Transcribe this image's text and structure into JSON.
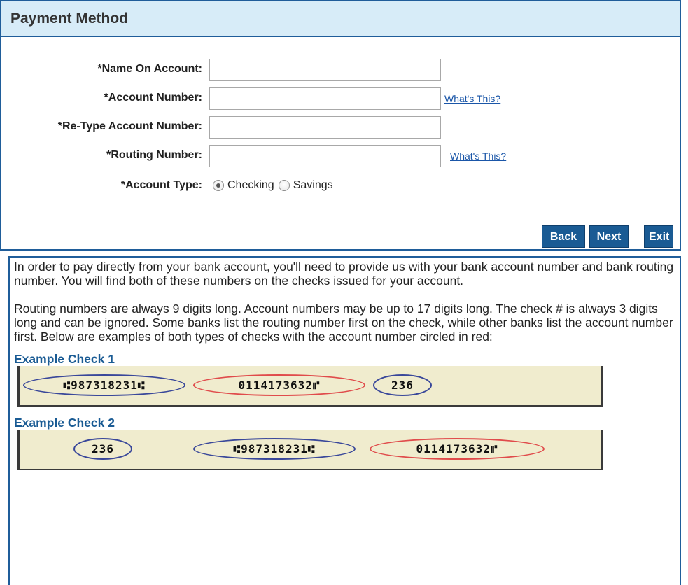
{
  "panel": {
    "title": "Payment Method",
    "fields": {
      "name_label": "*Name On Account:",
      "account_label": "*Account Number:",
      "retype_label": "*Re-Type Account Number:",
      "routing_label": "*Routing Number:",
      "type_label": "*Account Type:",
      "name_value": "",
      "account_value": "",
      "retype_value": "",
      "routing_value": ""
    },
    "whats_this": "What's This?",
    "account_types": {
      "checking": "Checking",
      "savings": "Savings",
      "selected": "Checking"
    },
    "buttons": {
      "back": "Back",
      "next": "Next",
      "exit": "Exit"
    }
  },
  "help": {
    "paragraph1": "In order to pay directly from your bank account, you'll need to provide us with your bank account number and bank routing number. You will find both of these numbers on the checks issued for your account.",
    "paragraph2": "Routing numbers are always 9 digits long. Account numbers may be up to 17 digits long. The check # is always 3 digits long and can be ignored. Some banks list the routing number first on the check, while other banks list the account number first. Below are examples of both types of checks with the account number circled in red:",
    "example1": {
      "title": "Example Check 1",
      "routing": "⑆987318231⑆",
      "account": "0114173632⑈",
      "check_no": "236"
    },
    "example2": {
      "title": "Example Check 2",
      "check_no": "236",
      "routing": "⑆987318231⑆",
      "account": "0114173632⑈"
    }
  },
  "colors": {
    "header_bg": "#d7ecf8",
    "border": "#1f5d9a",
    "button_bg": "#1a5b94",
    "link": "#1a56a8",
    "check_bg": "#f0ecce",
    "routing_circle": "#39479a",
    "account_circle": "#e04b4b"
  }
}
